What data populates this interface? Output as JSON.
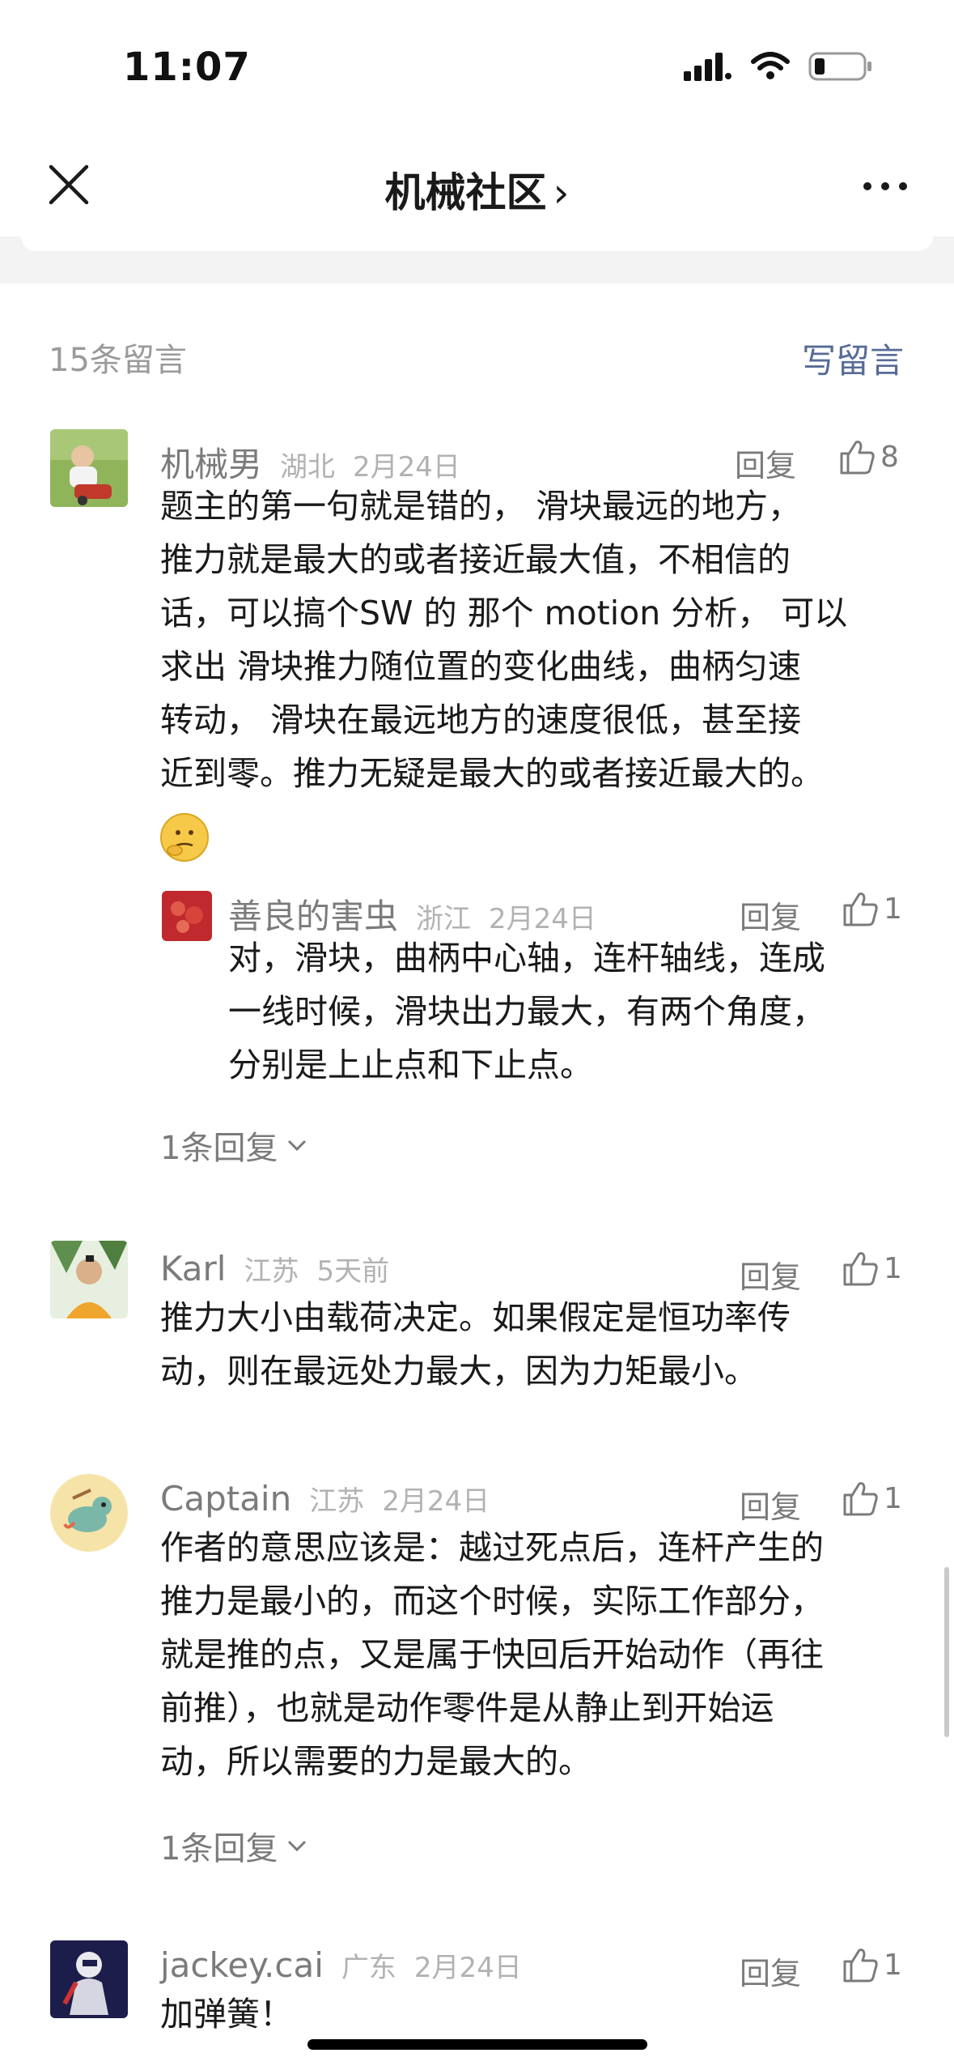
{
  "status_bar": {
    "time": "11:07"
  },
  "nav": {
    "title": "机械社区",
    "chevron": "›"
  },
  "section": {
    "count_label": "15条留言",
    "write_label": "写留言"
  },
  "comments": [
    {
      "name": "机械男",
      "region": "湖北",
      "date": "2月24日",
      "reply_label": "回复",
      "likes": "8",
      "lines": [
        "题主的第一句就是错的， 滑块最远的地方，",
        "推力就是最大的或者接近最大值，不相信的",
        "话，可以搞个SW 的 那个 motion 分析， 可以",
        "求出 滑块推力随位置的变化曲线，曲柄匀速",
        "转动， 滑块在最远地方的速度很低，甚至接",
        "近到零。推力无疑是最大的或者接近最大的。"
      ],
      "reply": {
        "name": "善良的害虫",
        "region": "浙江",
        "date": "2月24日",
        "reply_label": "回复",
        "likes": "1",
        "lines": [
          "对，滑块，曲柄中心轴，连杆轴线，连成",
          "一线时候，滑块出力最大，有两个角度，",
          "分别是上止点和下止点。"
        ]
      },
      "more_replies": "1条回复"
    },
    {
      "name": "Karl",
      "region": "江苏",
      "date": "5天前",
      "reply_label": "回复",
      "likes": "1",
      "lines": [
        "推力大小由载荷决定。如果假定是恒功率传",
        "动，则在最远处力最大，因为力矩最小。"
      ]
    },
    {
      "name": "Captain",
      "region": "江苏",
      "date": "2月24日",
      "reply_label": "回复",
      "likes": "1",
      "lines": [
        "作者的意思应该是：越过死点后，连杆产生的",
        "推力是最小的，而这个时候，实际工作部分，",
        "就是推的点，又是属于快回后开始动作（再往",
        "前推），也就是动作零件是从静止到开始运",
        "动，所以需要的力是最大的。"
      ],
      "more_replies": "1条回复"
    },
    {
      "name": "jackey.cai",
      "region": "广东",
      "date": "2月24日",
      "reply_label": "回复",
      "likes": "1",
      "lines": [
        "加弹簧！"
      ]
    }
  ],
  "colors": {
    "link": "#576b95",
    "meta": "#b2b2b2",
    "name": "#7b7b7b"
  },
  "icons": [
    "close-icon",
    "more-icon",
    "signal-icon",
    "wifi-icon",
    "battery-icon",
    "thumbs-up-icon",
    "chevron-down-icon",
    "thinking-emoji"
  ]
}
